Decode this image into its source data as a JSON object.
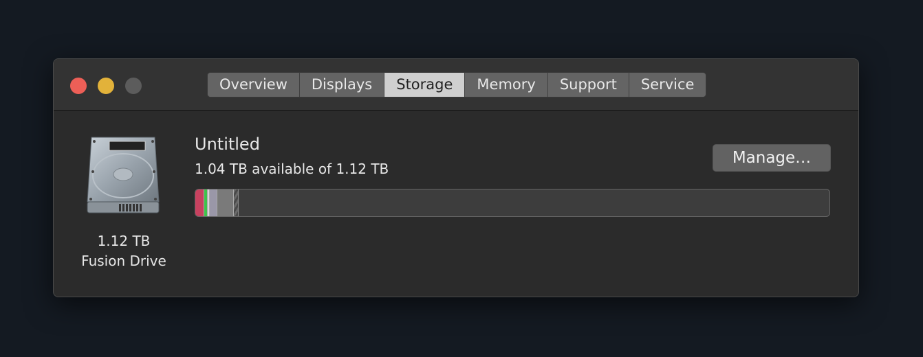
{
  "window": {
    "traffic_lights": {
      "close": "#ed5f57",
      "minimize": "#e2b23a",
      "zoom": "#5c5c5c"
    },
    "tabs": [
      {
        "label": "Overview",
        "active": false
      },
      {
        "label": "Displays",
        "active": false
      },
      {
        "label": "Storage",
        "active": true
      },
      {
        "label": "Memory",
        "active": false
      },
      {
        "label": "Support",
        "active": false
      },
      {
        "label": "Service",
        "active": false
      }
    ]
  },
  "drive": {
    "icon": "hard-drive-icon",
    "capacity": "1.12 TB",
    "type": "Fusion Drive"
  },
  "volume": {
    "name": "Untitled",
    "availability": "1.04 TB available of 1.12 TB",
    "manage_label": "Manage…",
    "usage_segments": [
      {
        "color": "#c8415f",
        "percent": 1.3
      },
      {
        "color": "#3fc24a",
        "percent": 0.5
      },
      {
        "color": "#d9d9d9",
        "percent": 0.4
      },
      {
        "color": "#9a97a8",
        "percent": 1.2
      },
      {
        "color": "#7a7a7a",
        "percent": 2.6
      },
      {
        "color": "hatched",
        "percent": 0.8
      }
    ]
  }
}
